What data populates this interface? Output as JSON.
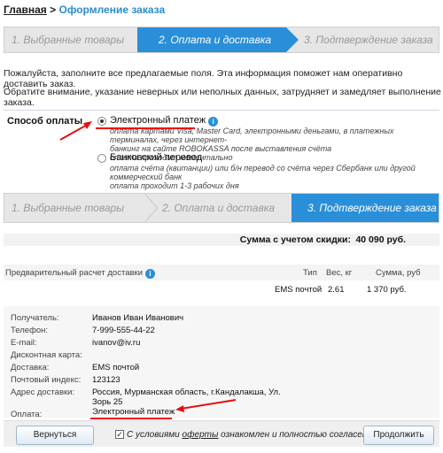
{
  "breadcrumb": {
    "home": "Главная",
    "separator": ">",
    "current": "Оформление заказа"
  },
  "steps_top": [
    "1. Выбранные товары",
    "2. Оплата и доставка",
    "3. Подтверждение заказа"
  ],
  "steps_bottom": [
    "1. Выбранные товары",
    "2. Оплата и доставка",
    "3. Подтверждение заказа"
  ],
  "info": {
    "line1": "Пожалуйста, заполните все предлагаемые поля. Эта информация поможет нам оперативно доставить заказ.",
    "line2": "Обратите внимание, указание неверных или неполных данных, затрудняет и замедляет выполнение заказа."
  },
  "payment": {
    "title": "Способ оплаты",
    "options": [
      {
        "label": "Электронный платеж",
        "info_icon": "info-icon",
        "desc1": "оплата картами Visa, Master Card, электронными деньгами, в платежных терминалах, через интернет-",
        "desc2": "банкинг на сайте ROBOKASSA после выставления счёта",
        "desc3": "оплата проходит моментально",
        "checked": true
      },
      {
        "label": "Банковский перевод",
        "desc1": "оплата счёта (квитанции) или б/н перевод со счёта через Сбербанк или другой коммерческий банк",
        "desc2": "оплата проходит 1-3 рабочих дня",
        "checked": false
      }
    ]
  },
  "summary": {
    "label": "Сумма с учетом скидки:",
    "value": "40 090 руб."
  },
  "shipping": {
    "title": "Предварительный расчет доставки",
    "headers": [
      "Тип",
      "Вес, кг",
      "Сумма, руб"
    ],
    "row": [
      "EMS почтой",
      "2.61",
      "1 370 руб."
    ]
  },
  "details": [
    {
      "label": "Получатель:",
      "value": "Иванов Иван Иванович"
    },
    {
      "label": "Телефон:",
      "value": "7-999-555-44-22"
    },
    {
      "label": "E-mail:",
      "value": "ivanov@iv.ru"
    },
    {
      "label": "Дисконтная карта:",
      "value": ""
    },
    {
      "label": "Доставка:",
      "value": "EMS почтой"
    },
    {
      "label": "Почтовый индекс:",
      "value": "123123"
    },
    {
      "label": "Адрес доставки:",
      "value": "Россия, Мурманская область, г.Кандалакша, Ул.",
      "value2": "Зорь 25"
    },
    {
      "label": "Оплата:",
      "value": "Электронный платеж"
    }
  ],
  "footer": {
    "back": "Вернуться",
    "agree_pre": "С условиями",
    "agree_link": "оферты",
    "agree_post": "ознакомлен и полностью согласен",
    "next": "Продолжить",
    "checkbox_mark": "✓"
  },
  "colors": {
    "accent": "#2a8fd9",
    "annotation": "#e11111"
  }
}
